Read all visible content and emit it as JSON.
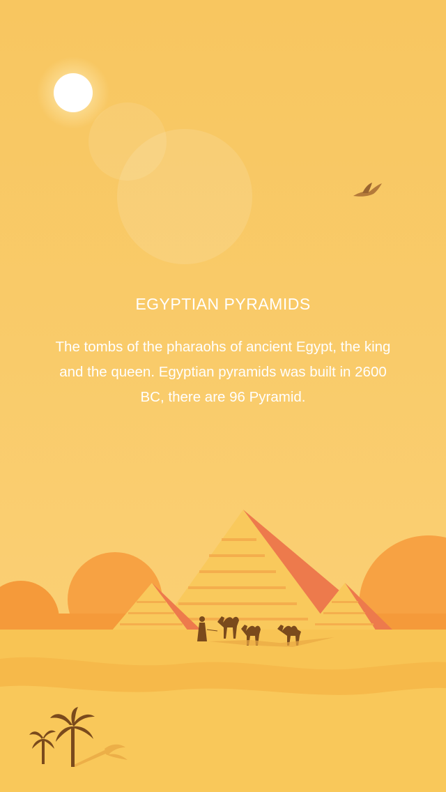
{
  "article": {
    "title": "EGYPTIAN PYRAMIDS",
    "description": "The tombs of the pharaohs of ancient Egypt, the king and the queen. Egyptian pyramids was built in 2600 BC, there are 96 Pyramid."
  },
  "icons": {
    "sun": "sun-icon",
    "bird": "bird-icon",
    "camel": "camel-icon",
    "palm": "palm-tree-icon"
  },
  "colors": {
    "sky": "#f8c660",
    "sand": "#f7c24f",
    "dune": "#f6ae3c",
    "pyramid_light": "#f9c95c",
    "pyramid_shadow": "#ed7a4c",
    "silhouette": "#7a4a1c"
  }
}
